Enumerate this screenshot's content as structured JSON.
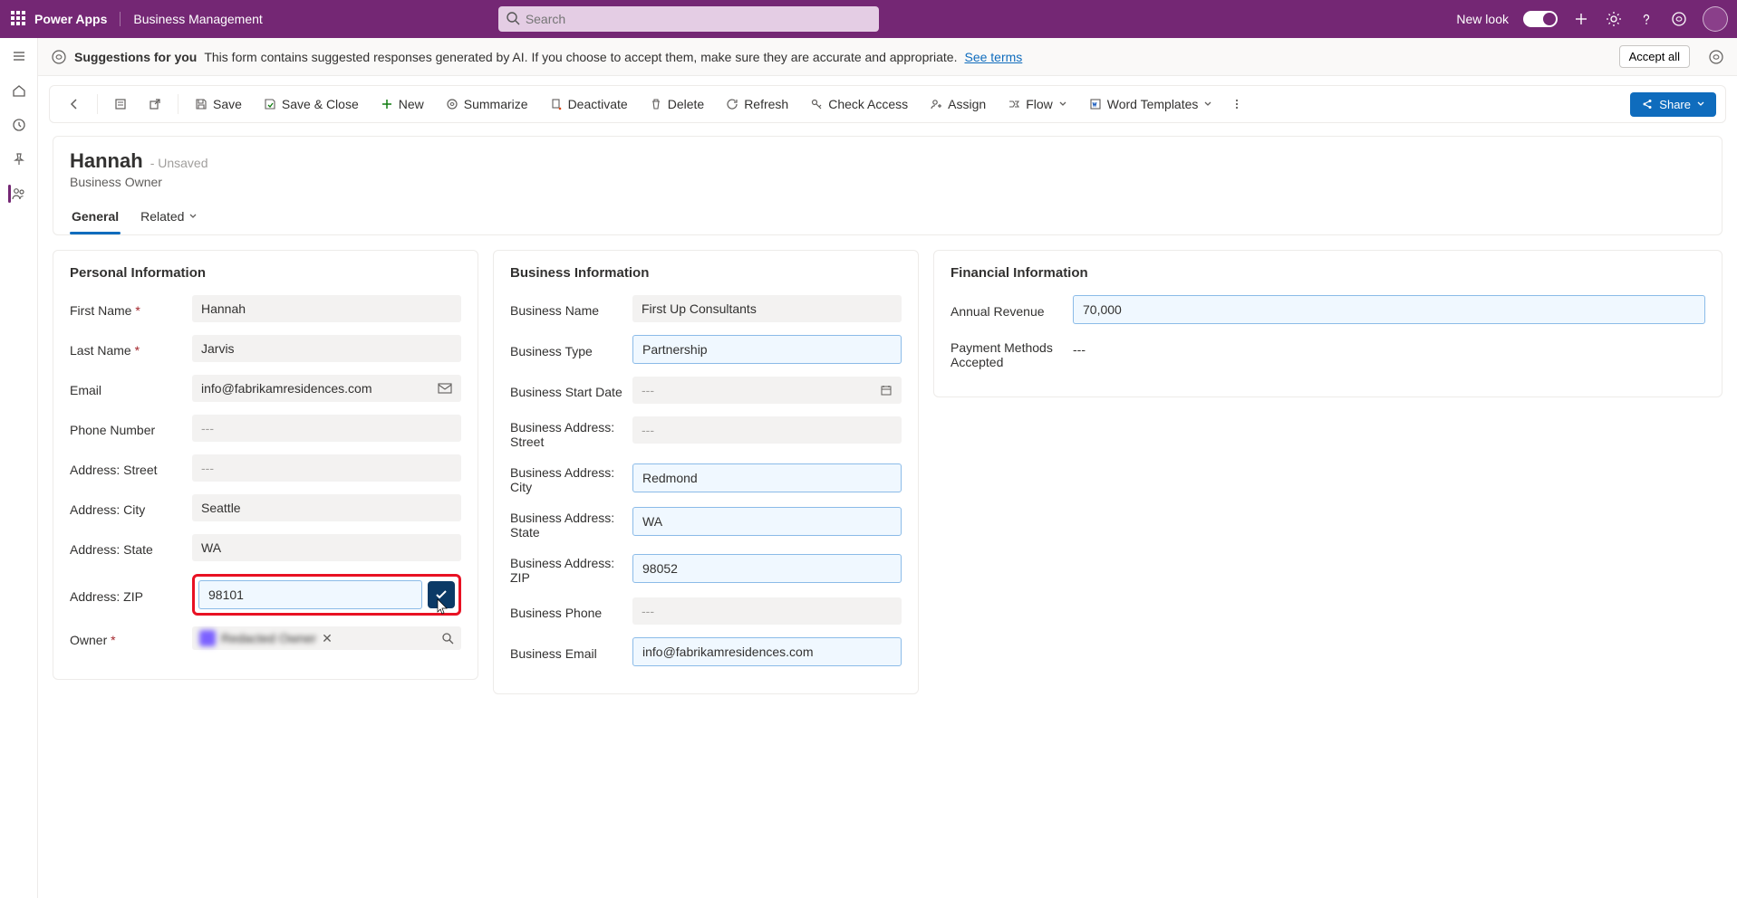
{
  "topbar": {
    "brand": "Power Apps",
    "appname": "Business Management",
    "search_placeholder": "Search",
    "newlook_label": "New look"
  },
  "suggestbar": {
    "bold": "Suggestions for you",
    "text": "This form contains suggested responses generated by AI. If you choose to accept them, make sure they are accurate and appropriate.",
    "link": "See terms",
    "accept_all": "Accept all"
  },
  "cmdbar": {
    "save": "Save",
    "save_close": "Save & Close",
    "new": "New",
    "summarize": "Summarize",
    "deactivate": "Deactivate",
    "delete": "Delete",
    "refresh": "Refresh",
    "check_access": "Check Access",
    "assign": "Assign",
    "flow": "Flow",
    "word_templates": "Word Templates",
    "share": "Share"
  },
  "record": {
    "title": "Hannah",
    "unsaved": "- Unsaved",
    "subtitle": "Business Owner"
  },
  "tabs": {
    "general": "General",
    "related": "Related"
  },
  "sections": {
    "personal": "Personal Information",
    "business": "Business Information",
    "financial": "Financial Information"
  },
  "personal": {
    "first_name_l": "First Name",
    "first_name": "Hannah",
    "last_name_l": "Last Name",
    "last_name": "Jarvis",
    "email_l": "Email",
    "email": "info@fabrikamresidences.com",
    "phone_l": "Phone Number",
    "phone": "---",
    "street_l": "Address: Street",
    "street": "---",
    "city_l": "Address: City",
    "city": "Seattle",
    "state_l": "Address: State",
    "state": "WA",
    "zip_l": "Address: ZIP",
    "zip": "98101",
    "owner_l": "Owner",
    "owner": "Redacted Owner"
  },
  "business": {
    "name_l": "Business Name",
    "name": "First Up Consultants",
    "type_l": "Business Type",
    "type": "Partnership",
    "start_l": "Business Start Date",
    "start": "---",
    "street_l": "Business Address: Street",
    "street": "---",
    "city_l": "Business Address: City",
    "city": "Redmond",
    "state_l": "Business Address: State",
    "state": "WA",
    "zip_l": "Business Address: ZIP",
    "zip": "98052",
    "phone_l": "Business Phone",
    "phone": "---",
    "email_l": "Business Email",
    "email": "info@fabrikamresidences.com"
  },
  "financial": {
    "revenue_l": "Annual Revenue",
    "revenue": "70,000",
    "payments_l": "Payment Methods Accepted",
    "payments": "---"
  }
}
